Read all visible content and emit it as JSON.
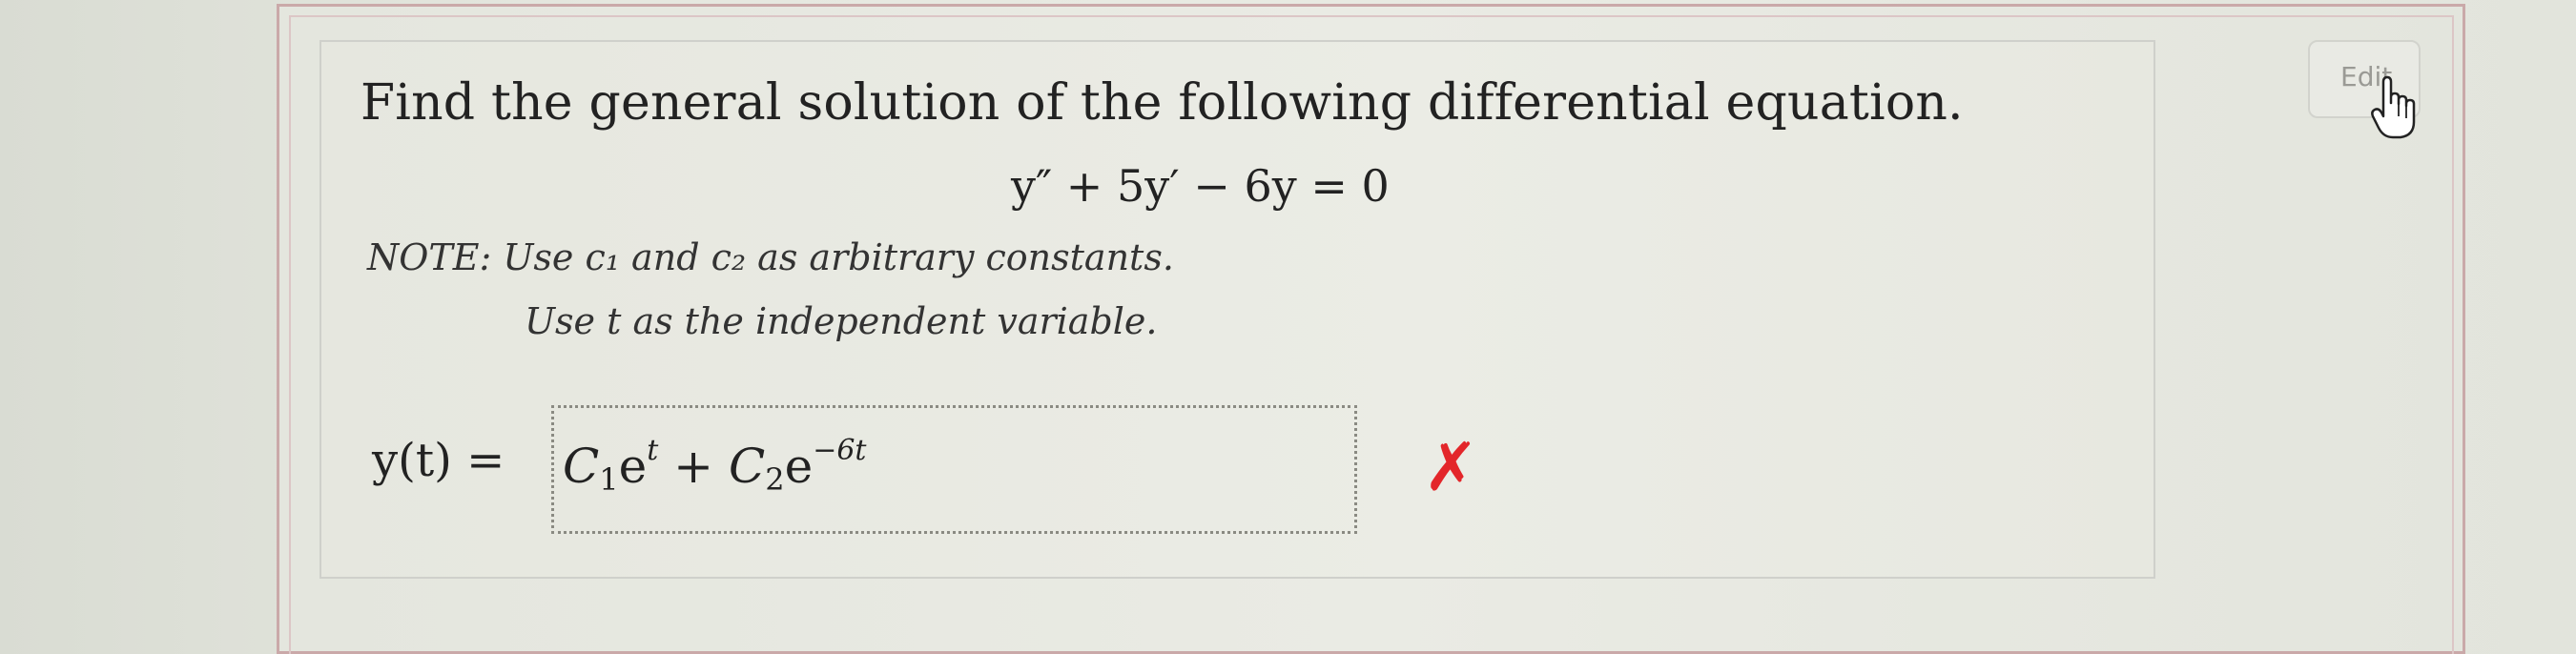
{
  "question": {
    "prompt": "Find the general solution of the following differential equation.",
    "equation": "y″ + 5y′ − 6y = 0",
    "note_line1": "NOTE: Use c₁ and c₂ as arbitrary constants.",
    "note_line2": "Use t as the independent variable."
  },
  "answer": {
    "label": "y(t) =",
    "value_parts": {
      "c1": "C",
      "c1_sub": "1",
      "exp1_base": "e",
      "exp1_sup": "t",
      "plus": " + ",
      "c2": "C",
      "c2_sub": "2",
      "exp2_base": "e",
      "exp2_sup": "−6t"
    },
    "status": "incorrect",
    "status_mark": "✗"
  },
  "toolbar": {
    "edit_label": "Edit"
  },
  "colors": {
    "wrong": "#e3262a",
    "frame": "#caa9a9"
  },
  "icons": {
    "cursor": "hand-pointer-icon",
    "status": "x-mark-icon"
  }
}
